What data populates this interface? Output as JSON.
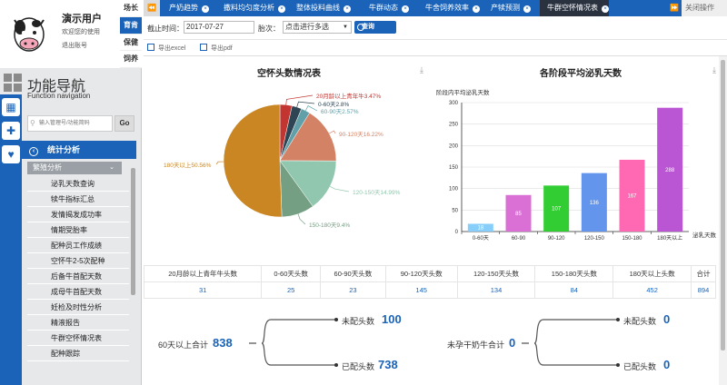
{
  "user": {
    "name": "演示用户",
    "welcome": "欢迎您的使用",
    "logout": "退出账号"
  },
  "mini_tabs": [
    "场长",
    "育肯",
    "保健",
    "饲养"
  ],
  "nav": {
    "title": "功能导航",
    "subtitle": "Function navigation",
    "search_placeholder": "输入管理号/功能简码",
    "go": "Go"
  },
  "menu": {
    "header": "统计分析",
    "submenu": "繁殖分析",
    "items": [
      "泌乳天数查询",
      "犊牛指标汇总",
      "发情揭发成功率",
      "情期受胎率",
      "配种员工作成绩",
      "空怀牛2-5次配种",
      "后备牛首配天数",
      "成母牛首配天数",
      "妊检及时性分析",
      "精液报告",
      "牛群空怀情况表",
      "配种跟踪"
    ]
  },
  "tabs": [
    {
      "label": "产奶趋势"
    },
    {
      "label": "撒料均匀度分析"
    },
    {
      "label": "整体投料曲线"
    },
    {
      "label": "牛群动态"
    },
    {
      "label": "牛舍饲养效率"
    },
    {
      "label": "产犊预测"
    },
    {
      "label": "牛群空怀情况表"
    }
  ],
  "close_ops": "关闭操作",
  "filter": {
    "date_label": "截止时间：",
    "date_value": "2017-07-27",
    "batch_label": "胎次：",
    "batch_value": "点击进行多选",
    "query": "查询"
  },
  "export": {
    "excel": "导出excel",
    "pdf": "导出pdf"
  },
  "pie_title": "空怀头数情况表",
  "bar_title": "各阶段平均泌乳天数",
  "chart_data": [
    {
      "type": "pie",
      "title": "空怀头数情况表",
      "slices": [
        {
          "label": "20月龄以上青年牛",
          "percent": 3.47,
          "text": "20月龄以上青年牛3.47%",
          "color": "#c23531"
        },
        {
          "label": "0-60天",
          "percent": 2.8,
          "text": "0-60天2.8%",
          "color": "#2f4554"
        },
        {
          "label": "60-90天",
          "percent": 2.57,
          "text": "60-90天2.57%",
          "color": "#61a0a8"
        },
        {
          "label": "90-120天",
          "percent": 16.22,
          "text": "90-120天16.22%",
          "color": "#d48265"
        },
        {
          "label": "120-150天",
          "percent": 14.99,
          "text": "120-150天14.99%",
          "color": "#91c7ae"
        },
        {
          "label": "150-180天",
          "percent": 9.4,
          "text": "150-180天9.4%",
          "color": "#749f83"
        },
        {
          "label": "180天以上",
          "percent": 50.56,
          "text": "180天以上50.56%",
          "color": "#ca8622"
        }
      ]
    },
    {
      "type": "bar",
      "title": "各阶段平均泌乳天数",
      "ylabel": "阶段内平均泌乳天数",
      "xlabel": "泌乳天数",
      "ylim": [
        0,
        300
      ],
      "yticks": [
        0,
        50,
        100,
        150,
        200,
        250,
        300
      ],
      "categories": [
        "0-60天",
        "60-90",
        "90-120",
        "120-150",
        "150-180",
        "180天以上"
      ],
      "values": [
        18,
        85,
        107,
        136,
        167,
        288
      ],
      "colors": [
        "#87cefa",
        "#da70d6",
        "#32cd32",
        "#6495ed",
        "#ff69b4",
        "#ba55d3"
      ]
    }
  ],
  "summary": {
    "headers": [
      "20月龄以上青年牛头数",
      "0-60天头数",
      "60-90天头数",
      "90-120天头数",
      "120-150天头数",
      "150-180天头数",
      "180天以上头数",
      "合计"
    ],
    "values": [
      "31",
      "25",
      "23",
      "145",
      "134",
      "84",
      "452",
      "894"
    ]
  },
  "tree1": {
    "root_label": "60天以上合计",
    "root_value": "838",
    "top_label": "未配头数",
    "top_value": "100",
    "bottom_label": "已配头数",
    "bottom_value": "738"
  },
  "tree2": {
    "root_label": "未孕干奶牛合计",
    "root_value": "0",
    "top_label": "未配头数",
    "top_value": "0",
    "bottom_label": "已配头数",
    "bottom_value": "0"
  }
}
